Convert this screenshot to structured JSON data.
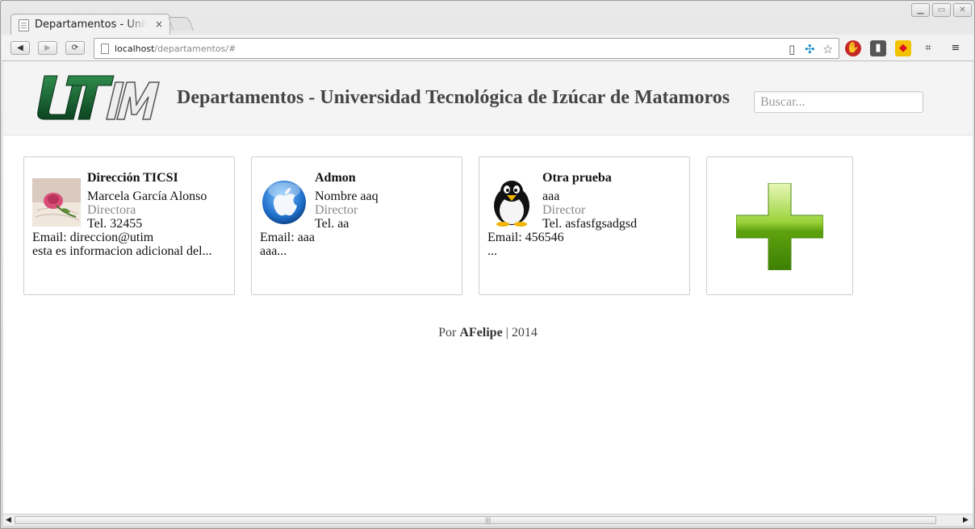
{
  "browser": {
    "tab_title": "Departamentos - Universidad Tecnológica de Izúcar de Matamoros",
    "tab_close": "×",
    "url_host": "localhost",
    "url_path": "/departamentos/#"
  },
  "header": {
    "title": "Departamentos - Universidad Tecnológica de Izúcar de Matamoros",
    "search_placeholder": "Buscar...",
    "logo_text": "UTIM"
  },
  "cards": [
    {
      "name": "Dirección TICSI",
      "person": "Marcela García Alonso",
      "role": "Directora",
      "tel": "Tel. 32455",
      "email": "Email: direccion@utim",
      "info": "esta es informacion adicional del...",
      "avatar_icon": "rose-photo"
    },
    {
      "name": "Admon",
      "person": "Nombre aaq",
      "role": "Director",
      "tel": "Tel. aa",
      "email": "Email: aaa",
      "info": "aaa...",
      "avatar_icon": "apple-logo-icon"
    },
    {
      "name": "Otra prueba",
      "person": "aaa",
      "role": "Director",
      "tel": "Tel. asfasfgsadgsd",
      "email": "Email: 456546",
      "info": "...",
      "avatar_icon": "penguin-icon"
    }
  ],
  "add_card": {
    "icon": "plus-icon",
    "color": "#5fa30f"
  },
  "footer": {
    "prefix": "Por",
    "author": "AFelipe",
    "suffix": "| 2014"
  },
  "colors": {
    "header_bg": "#f4f4f4",
    "title": "#444444",
    "role_text": "#888888",
    "logo_green": "#1f6b3a"
  }
}
